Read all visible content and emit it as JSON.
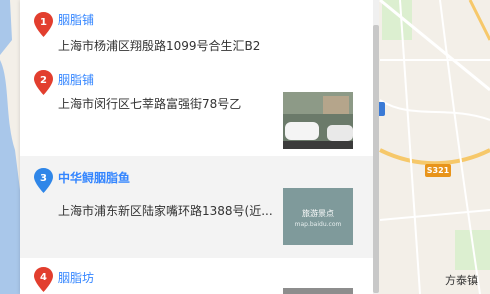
{
  "results": [
    {
      "index": "1",
      "name": "胭脂铺",
      "address": "上海市杨浦区翔殷路1099号合生汇B2",
      "pin_color": "#e23e2e"
    },
    {
      "index": "2",
      "name": "胭脂铺",
      "address": "上海市闵行区七莘路富强街78号乙",
      "pin_color": "#e23e2e"
    },
    {
      "index": "3",
      "name": "中华鲟胭脂鱼",
      "address": "上海市浦东新区陆家嘴环路1388号(近...",
      "pin_color": "#2f86e8",
      "thumb_caption": "旅游景点",
      "thumb_source": "map.baidu.com"
    },
    {
      "index": "4",
      "name": "胭脂坊",
      "address": "",
      "pin_color": "#e23e2e"
    }
  ],
  "map": {
    "road_tag": "S321",
    "town_label": "方泰镇"
  },
  "colors": {
    "link": "#3385ff",
    "pin_red": "#e23e2e",
    "pin_blue": "#2f86e8"
  }
}
